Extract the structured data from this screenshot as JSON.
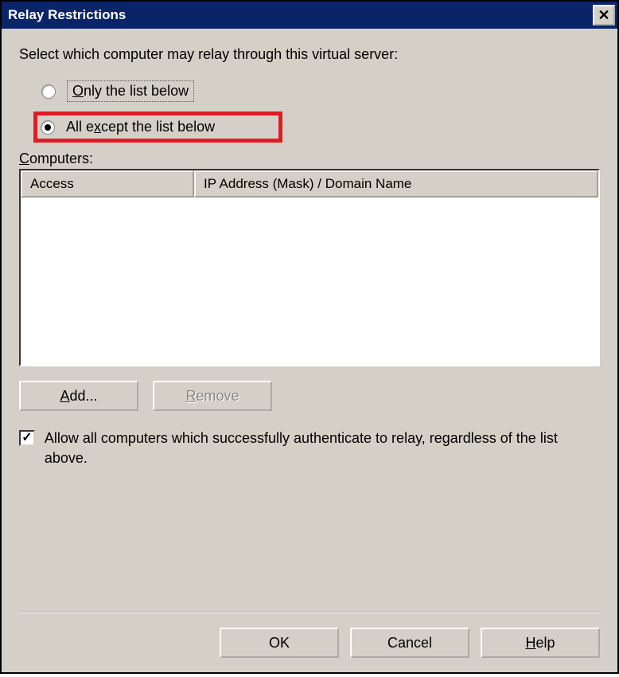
{
  "title": "Relay Restrictions",
  "instructions": "Select which computer may relay through this virtual server:",
  "radios": {
    "only": {
      "pre": "O",
      "rest": "nly the list below",
      "selected": false
    },
    "except": {
      "pre": "All e",
      "u": "x",
      "rest": "cept the list below",
      "selected": true
    }
  },
  "computers_label": {
    "u": "C",
    "rest": "omputers:"
  },
  "columns": {
    "access": "Access",
    "ip": "IP Address (Mask) / Domain Name"
  },
  "buttons": {
    "add": {
      "u": "A",
      "rest": "dd..."
    },
    "remove": {
      "u": "R",
      "rest": "emove",
      "disabled": true
    }
  },
  "checkbox": {
    "checked": true,
    "label": "Allow all computers which successfully authenticate to relay, regardless of the list above."
  },
  "bottom": {
    "ok": "OK",
    "cancel": "Cancel",
    "help": {
      "u": "H",
      "rest": "elp"
    }
  }
}
